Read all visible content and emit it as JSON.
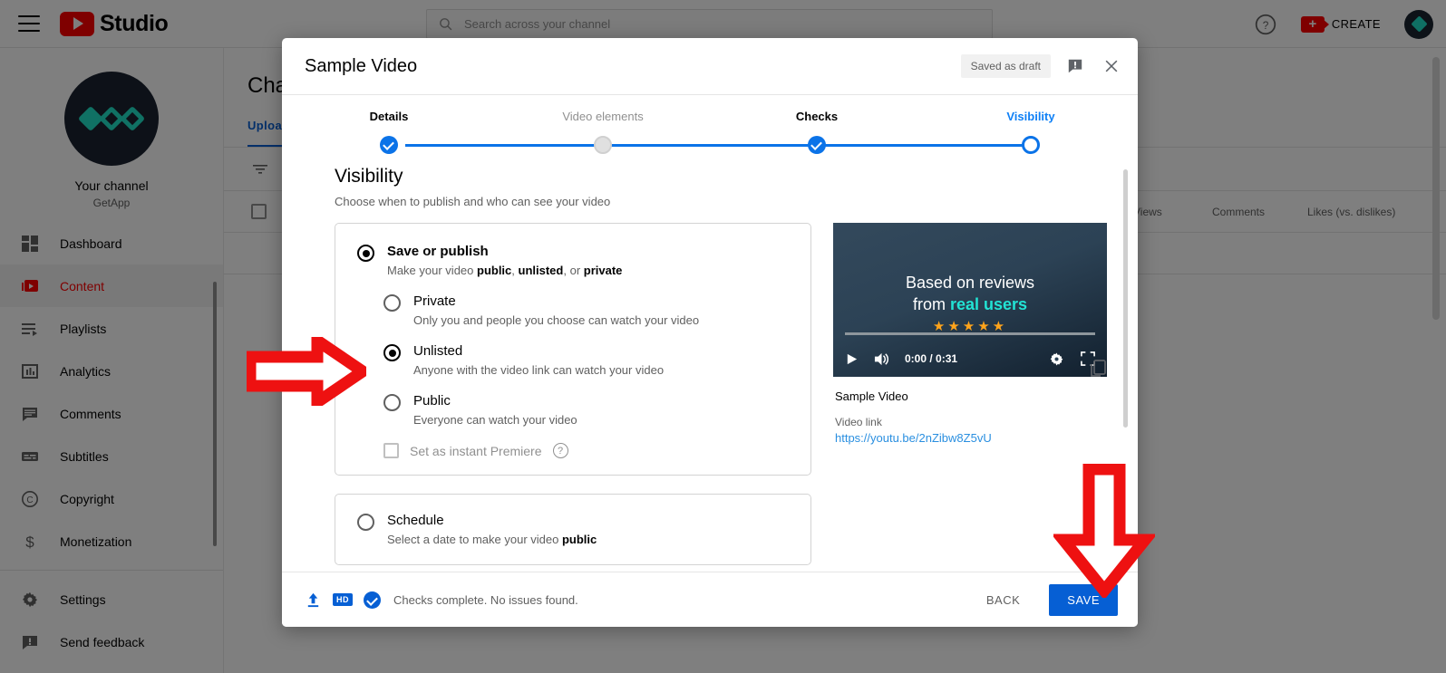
{
  "topbar": {
    "menu_icon": "hamburger-icon",
    "logo_text": "Studio",
    "search_placeholder": "Search across your channel",
    "search_value": "",
    "help_icon": "help-circle-icon",
    "create_label": "CREATE",
    "avatar": "channel-avatar"
  },
  "sidebar": {
    "channel_label": "Your channel",
    "channel_name": "GetApp",
    "items": [
      {
        "label": "Dashboard",
        "icon": "dashboard-icon",
        "active": false
      },
      {
        "label": "Content",
        "icon": "content-video-icon",
        "active": true
      },
      {
        "label": "Playlists",
        "icon": "playlist-icon",
        "active": false
      },
      {
        "label": "Analytics",
        "icon": "analytics-icon",
        "active": false
      },
      {
        "label": "Comments",
        "icon": "comments-icon",
        "active": false
      },
      {
        "label": "Subtitles",
        "icon": "subtitles-icon",
        "active": false
      },
      {
        "label": "Copyright",
        "icon": "copyright-icon",
        "active": false
      },
      {
        "label": "Monetization",
        "icon": "dollar-icon",
        "active": false
      },
      {
        "label": "Settings",
        "icon": "gear-icon",
        "active": false
      },
      {
        "label": "Send feedback",
        "icon": "feedback-icon",
        "active": false
      }
    ]
  },
  "main": {
    "page_title": "Channel content",
    "tabs": [
      {
        "label": "Uploads",
        "active": true
      }
    ],
    "columns": [
      "Views",
      "Comments",
      "Likes (vs. dislikes)"
    ]
  },
  "dialog": {
    "title": "Sample Video",
    "draft_badge": "Saved as draft",
    "feedback_icon": "feedback-icon",
    "close_icon": "close-icon",
    "steps": [
      {
        "label": "Details",
        "state": "done"
      },
      {
        "label": "Video elements",
        "state": "pending"
      },
      {
        "label": "Checks",
        "state": "done"
      },
      {
        "label": "Visibility",
        "state": "current"
      }
    ],
    "section": {
      "title": "Visibility",
      "subtitle": "Choose when to publish and who can see your video"
    },
    "save_or_publish": {
      "label": "Save or publish",
      "desc_prefix": "Make your video ",
      "desc_b1": "public",
      "desc_mid1": ", ",
      "desc_b2": "unlisted",
      "desc_mid2": ", or ",
      "desc_b3": "private",
      "selected": true
    },
    "sub_options": [
      {
        "label": "Private",
        "desc": "Only you and people you choose can watch your video",
        "selected": false
      },
      {
        "label": "Unlisted",
        "desc": "Anyone with the video link can watch your video",
        "selected": true
      },
      {
        "label": "Public",
        "desc": "Everyone can watch your video",
        "selected": false
      }
    ],
    "premiere": {
      "label": "Set as instant Premiere",
      "checked": false,
      "help_icon": "help-circle-icon"
    },
    "schedule": {
      "label": "Schedule",
      "desc_prefix": "Select a date to make your video ",
      "desc_bold": "public",
      "selected": false
    },
    "preview": {
      "thumb_line1": "Based on reviews",
      "thumb_line2_plain": "from ",
      "thumb_line2_bold": "real users",
      "thumb_stars": "★★★★★",
      "play_icon": "play-icon",
      "volume_icon": "volume-icon",
      "time": "0:00 / 0:31",
      "settings_icon": "gear-icon",
      "fullscreen_icon": "fullscreen-icon",
      "video_title": "Sample Video",
      "link_label": "Video link",
      "link_url": "https://youtu.be/2nZibw8Z5vU",
      "copy_icon": "copy-icon"
    },
    "footer": {
      "upload_icon": "upload-icon",
      "hd_badge": "HD",
      "check_icon": "check-circle-icon",
      "status": "Checks complete. No issues found.",
      "back_label": "BACK",
      "save_label": "SAVE"
    }
  },
  "annotations": {
    "arrow_right": "red-arrow-right",
    "arrow_down": "red-arrow-down",
    "color": "#ee1111"
  },
  "colors": {
    "accent_blue": "#065fd4",
    "brand_red": "#ff0000",
    "step_blue": "#0b73e8"
  }
}
